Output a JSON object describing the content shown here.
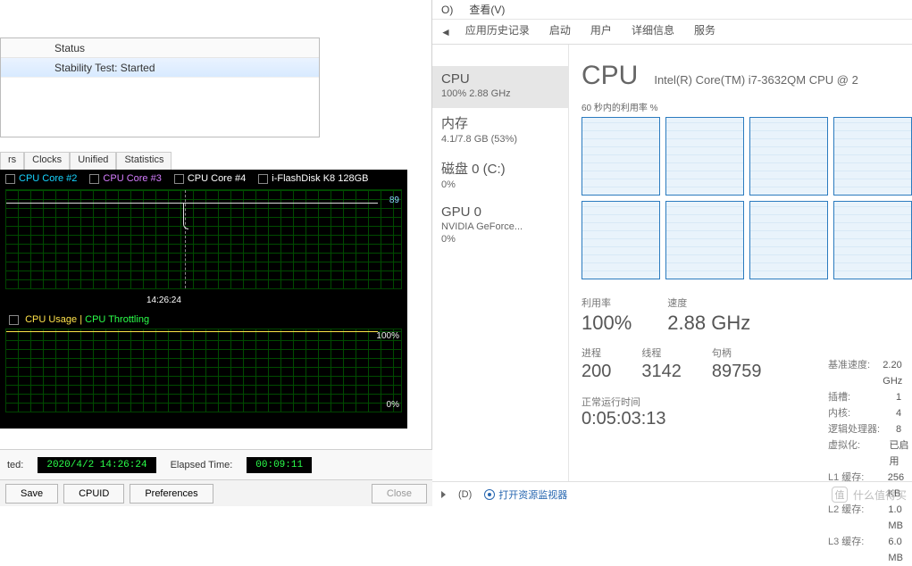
{
  "left": {
    "status_header": "Status",
    "status_text": "Stability Test: Started",
    "tabs": {
      "t0": "rs",
      "t1": "Clocks",
      "t2": "Unified",
      "t3": "Statistics"
    },
    "legend": {
      "core2": "CPU Core #2",
      "core3": "CPU Core #3",
      "core4": "CPU Core #4",
      "flash": "i-FlashDisk K8  128GB"
    },
    "graph1_peak": "89",
    "graph1_ts": "14:26:24",
    "legend2_a": "CPU Usage",
    "legend2_sep": "|",
    "legend2_b": "CPU Throttling",
    "g2_100": "100%",
    "g2_0": "0%",
    "started_label": "ted:",
    "started_val": "2020/4/2 14:26:24",
    "elapsed_label": "Elapsed Time:",
    "elapsed_val": "00:09:11",
    "btn_save": "Save",
    "btn_cpuid": "CPUID",
    "btn_prefs": "Preferences",
    "btn_close": "Close"
  },
  "tm": {
    "menu": {
      "m0": "O)",
      "m1": "查看(V)"
    },
    "tabs": {
      "t0": "应用历史记录",
      "t1": "启动",
      "t2": "用户",
      "t3": "详细信息",
      "t4": "服务"
    },
    "side": {
      "cpu_t": "CPU",
      "cpu_s": "100% 2.88 GHz",
      "mem_t": "内存",
      "mem_s": "4.1/7.8 GB (53%)",
      "disk_t": "磁盘 0 (C:)",
      "disk_s": "0%",
      "gpu_t": "GPU 0",
      "gpu_s1": "NVIDIA GeForce...",
      "gpu_s2": "0%"
    },
    "head_big": "CPU",
    "head_name": "Intel(R) Core(TM) i7-3632QM CPU @ 2",
    "sublabel": "60 秒内的利用率 %",
    "stat_util_l": "利用率",
    "stat_util_v": "100%",
    "stat_spd_l": "速度",
    "stat_spd_v": "2.88 GHz",
    "proc_l": "进程",
    "proc_v": "200",
    "thr_l": "线程",
    "thr_v": "3142",
    "hnd_l": "句柄",
    "hnd_v": "89759",
    "up_l": "正常运行时间",
    "up_v": "0:05:03:13",
    "spec": {
      "base_k": "基准速度:",
      "base_v": "2.20 GHz",
      "sock_k": "插槽:",
      "sock_v": "1",
      "core_k": "内核:",
      "core_v": "4",
      "lp_k": "逻辑处理器:",
      "lp_v": "8",
      "virt_k": "虚拟化:",
      "virt_v": "已启用",
      "l1_k": "L1 缓存:",
      "l1_v": "256 KB",
      "l2_k": "L2 缓存:",
      "l2_v": "1.0 MB",
      "l3_k": "L3 缓存:",
      "l3_v": "6.0 MB"
    },
    "foot_less": "(D)",
    "foot_link": "打开资源监视器"
  },
  "wm": "什么值得买"
}
